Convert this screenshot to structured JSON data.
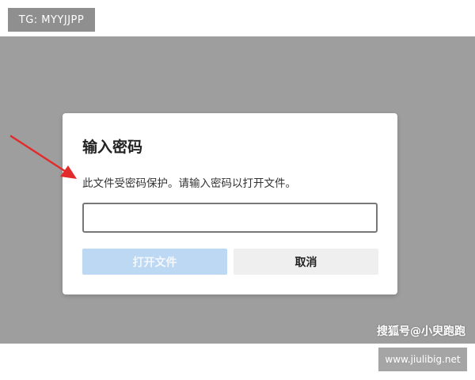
{
  "overlay_tag": "TG: MYYJJPP",
  "dialog": {
    "title": "输入密码",
    "message": "此文件受密码保护。请输入密码以打开文件。",
    "password_value": "",
    "open_button": "打开文件",
    "cancel_button": "取消"
  },
  "watermarks": {
    "sohu": "搜狐号@小臾跑跑",
    "site": "www.jiulibig.net"
  },
  "colors": {
    "backdrop": "#9e9e9e",
    "open_button_disabled": "#bcd8f3",
    "cancel_button": "#efefef",
    "arrow": "#e32b2b"
  },
  "icons": {
    "annotation": "red-arrow-icon"
  }
}
